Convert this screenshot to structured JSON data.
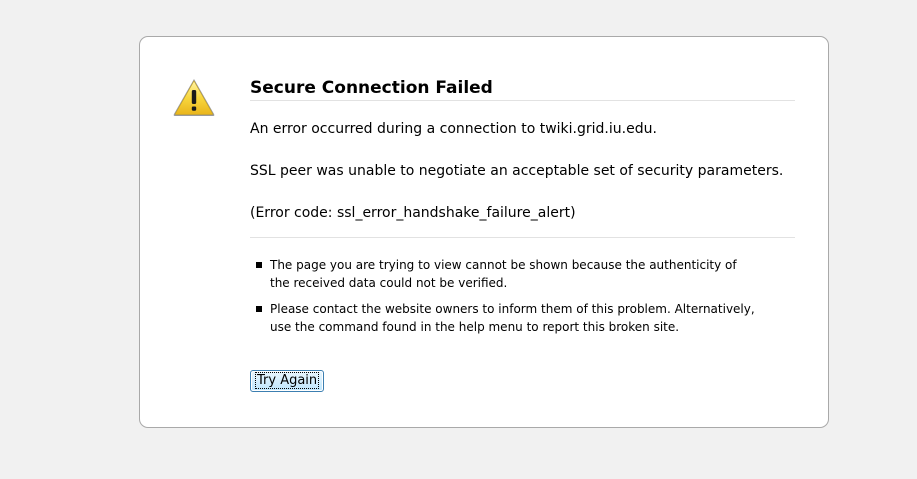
{
  "error": {
    "title": "Secure Connection Failed",
    "message": "An error occurred during a connection to twiki.grid.iu.edu.",
    "detail": "SSL peer was unable to negotiate an acceptable set of security parameters.",
    "error_code": "(Error code: ssl_error_handshake_failure_alert)",
    "bullets": [
      "The page you are trying to view cannot be shown because the authenticity of the received data could not be verified.",
      "Please contact the website owners to inform them of this problem. Alternatively, use the command found in the help menu to report this broken site."
    ],
    "try_again_label": "Try Again",
    "icon": "warning-icon"
  },
  "colors": {
    "background": "#f1f1f1",
    "box_background": "#ffffff",
    "box_border": "#a9a9a9",
    "icon_yellow": "#f6d33c",
    "button_border": "#3c7fb1"
  }
}
